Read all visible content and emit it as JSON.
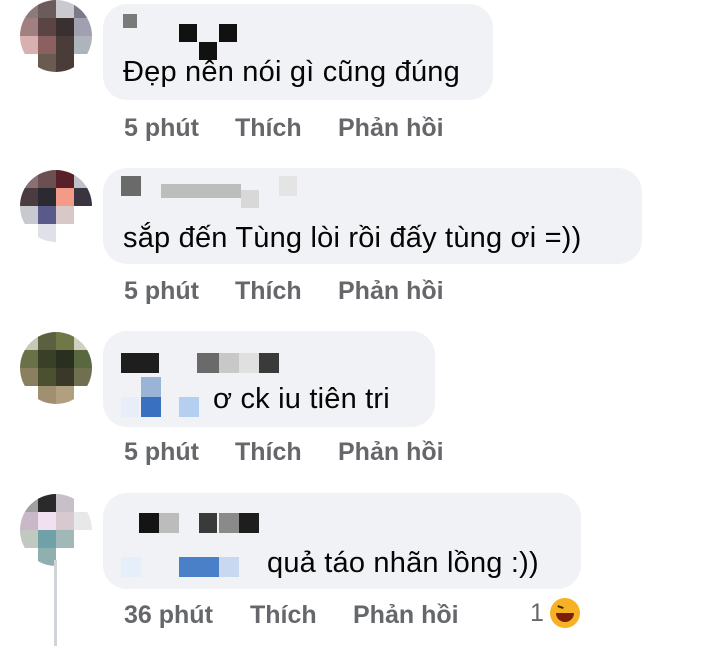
{
  "comments": [
    {
      "text": "Đẹp nên nói gì cũng đúng",
      "time": "5 phút",
      "like": "Thích",
      "reply": "Phản hồi",
      "author_obscured_fragment": "Đ"
    },
    {
      "text": "sắp đến Tùng lòi rồi đấy tùng ơi =))",
      "time": "5 phút",
      "like": "Thích",
      "reply": "Phản hồi",
      "author_obscured_fragment": "ĐO VI N"
    },
    {
      "text": "ơ ck iu tiên tri",
      "time": "5 phút",
      "like": "Thích",
      "reply": "Phản hồi",
      "author_obscured_fragment": "nl"
    },
    {
      "text": "quả táo nhãn lồng :))",
      "time": "36 phút",
      "like": "Thích",
      "reply": "Phản hồi",
      "reaction_count": "1",
      "reaction_icon": "haha-emoji-icon",
      "author_obscured_fragment": "Nguy ê"
    }
  ],
  "colors": {
    "bubble": "#f0f2f5",
    "text": "#050505",
    "meta": "#65676b",
    "reaction": "#f7b125"
  }
}
